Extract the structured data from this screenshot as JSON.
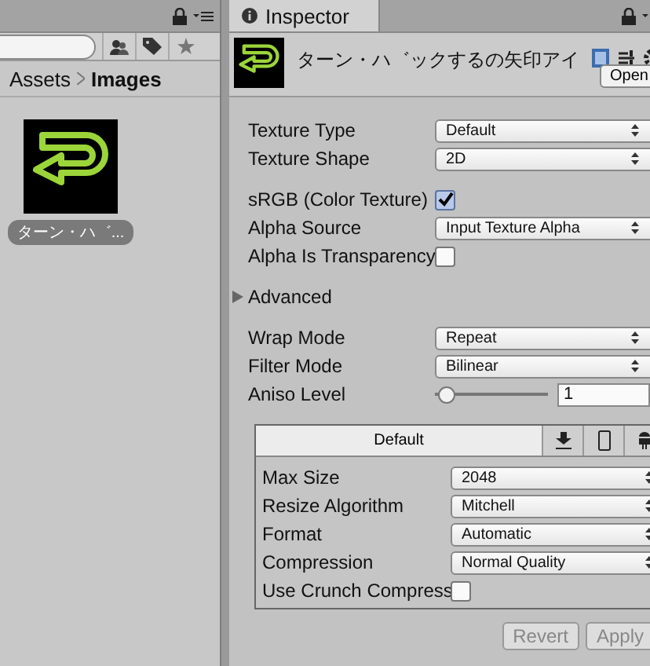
{
  "project": {
    "breadcrumb": [
      "Assets",
      "Images"
    ],
    "assets": [
      {
        "name": "ターン・ハ゛...",
        "selected": true
      }
    ]
  },
  "inspector": {
    "tab": "Inspector",
    "title": "ターン・ハ゛ックするの矢印アイ",
    "open_button": "Open",
    "groups": [
      [
        {
          "kind": "dropdown",
          "label": "Texture Type",
          "value": "Default"
        },
        {
          "kind": "dropdown",
          "label": "Texture Shape",
          "value": "2D"
        }
      ],
      [
        {
          "kind": "checkbox",
          "label": "sRGB (Color Texture)",
          "checked": true
        },
        {
          "kind": "dropdown",
          "label": "Alpha Source",
          "value": "Input Texture Alpha"
        },
        {
          "kind": "checkbox",
          "label": "Alpha Is Transparency",
          "checked": false
        }
      ],
      [
        {
          "kind": "foldout",
          "label": "Advanced",
          "expanded": false
        }
      ],
      [
        {
          "kind": "dropdown",
          "label": "Wrap Mode",
          "value": "Repeat"
        },
        {
          "kind": "dropdown",
          "label": "Filter Mode",
          "value": "Bilinear"
        },
        {
          "kind": "slider",
          "label": "Aniso Level",
          "level": 0.03,
          "value": "1"
        }
      ]
    ],
    "platforms": {
      "tabs": [
        {
          "kind": "text",
          "label": "Default",
          "selected": true
        },
        {
          "kind": "download",
          "selected": false
        },
        {
          "kind": "phone",
          "selected": false
        },
        {
          "kind": "robot",
          "selected": false
        }
      ],
      "rows": [
        {
          "kind": "dropdown",
          "label": "Max Size",
          "value": "2048"
        },
        {
          "kind": "dropdown",
          "label": "Resize Algorithm",
          "value": "Mitchell"
        },
        {
          "kind": "dropdown",
          "label": "Format",
          "value": "Automatic"
        },
        {
          "kind": "dropdown",
          "label": "Compression",
          "value": "Normal Quality"
        },
        {
          "kind": "checkbox",
          "label": "Use Crunch Compress",
          "checked": false
        }
      ]
    },
    "buttons": [
      {
        "label": "Revert",
        "disabled": true
      },
      {
        "label": "Apply",
        "disabled": true
      }
    ]
  }
}
